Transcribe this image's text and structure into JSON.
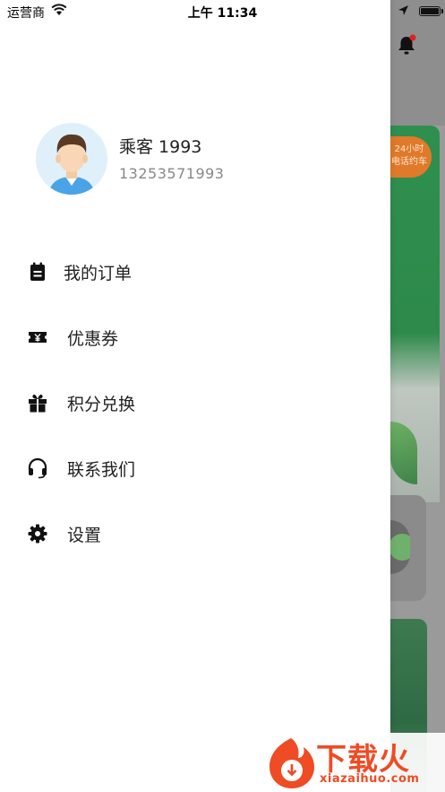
{
  "status_bar": {
    "carrier": "运营商",
    "time": "上午 11:34"
  },
  "background": {
    "hotline_badge_line1": "24小时",
    "hotline_badge_line2": "电话约车"
  },
  "profile": {
    "name": "乘客 1993",
    "phone": "13253571993"
  },
  "menu": {
    "items": [
      {
        "label": "我的订单",
        "icon": "order-list-icon"
      },
      {
        "label": "优惠券",
        "icon": "coupon-icon"
      },
      {
        "label": "积分兑换",
        "icon": "gift-icon"
      },
      {
        "label": "联系我们",
        "icon": "headset-icon"
      },
      {
        "label": "设置",
        "icon": "gear-icon"
      }
    ]
  },
  "watermark": {
    "text": "下载火",
    "domain": "xiazaihuo.com"
  },
  "colors": {
    "accent_orange": "#ef4b24",
    "notification_dot": "#e02020",
    "avatar_bg": "#dff0fb"
  }
}
